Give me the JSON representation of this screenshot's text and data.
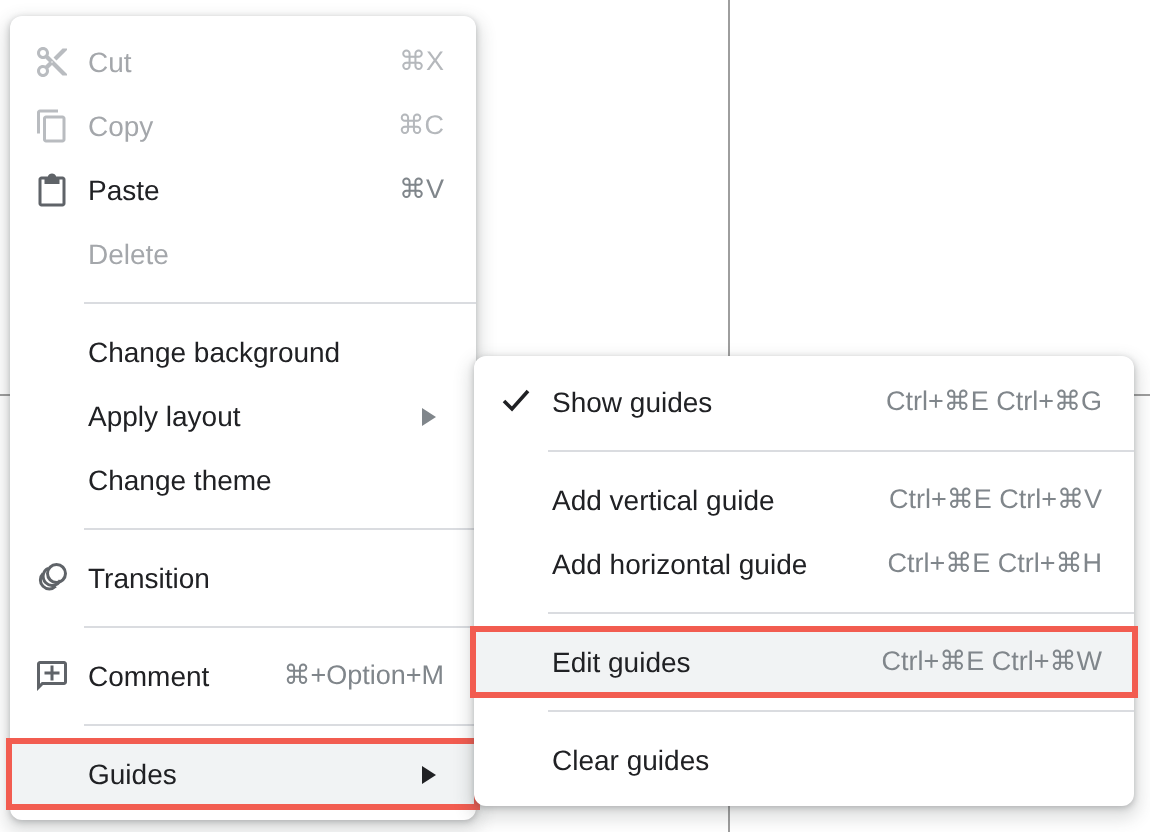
{
  "context_menu": {
    "items": [
      {
        "kind": "item",
        "label": "Cut",
        "shortcut": "⌘X",
        "disabled": true,
        "selected": false,
        "submenu": false
      },
      {
        "kind": "item",
        "label": "Copy",
        "shortcut": "⌘C",
        "disabled": true,
        "selected": false,
        "submenu": false
      },
      {
        "kind": "item",
        "label": "Paste",
        "shortcut": "⌘V",
        "disabled": false,
        "selected": false,
        "submenu": false
      },
      {
        "kind": "item",
        "label": "Delete",
        "disabled": true,
        "selected": false,
        "submenu": false
      },
      {
        "kind": "divider"
      },
      {
        "kind": "item",
        "label": "Change background",
        "disabled": false,
        "selected": false,
        "submenu": false
      },
      {
        "kind": "item",
        "label": "Apply layout",
        "disabled": false,
        "selected": false,
        "submenu": true
      },
      {
        "kind": "item",
        "label": "Change theme",
        "disabled": false,
        "selected": false,
        "submenu": false
      },
      {
        "kind": "divider"
      },
      {
        "kind": "item",
        "label": "Transition",
        "disabled": false,
        "selected": false,
        "submenu": false
      },
      {
        "kind": "divider"
      },
      {
        "kind": "item",
        "label": "Comment",
        "shortcut": "⌘+Option+M",
        "disabled": false,
        "selected": false,
        "submenu": false
      },
      {
        "kind": "divider"
      },
      {
        "kind": "item",
        "label": "Guides",
        "disabled": false,
        "selected": true,
        "submenu": true
      }
    ]
  },
  "guides_submenu": {
    "items": [
      {
        "kind": "item",
        "label": "Show guides",
        "shortcut": "Ctrl+⌘E Ctrl+⌘G",
        "checked": true,
        "selected": false
      },
      {
        "kind": "divider"
      },
      {
        "kind": "item",
        "label": "Add vertical guide",
        "shortcut": "Ctrl+⌘E Ctrl+⌘V",
        "checked": false,
        "selected": false
      },
      {
        "kind": "item",
        "label": "Add horizontal guide",
        "shortcut": "Ctrl+⌘E Ctrl+⌘H",
        "checked": false,
        "selected": false
      },
      {
        "kind": "divider"
      },
      {
        "kind": "item",
        "label": "Edit guides",
        "shortcut": "Ctrl+⌘E Ctrl+⌘W",
        "checked": false,
        "selected": true
      },
      {
        "kind": "divider"
      },
      {
        "kind": "item",
        "label": "Clear guides",
        "checked": false,
        "selected": false
      }
    ]
  }
}
